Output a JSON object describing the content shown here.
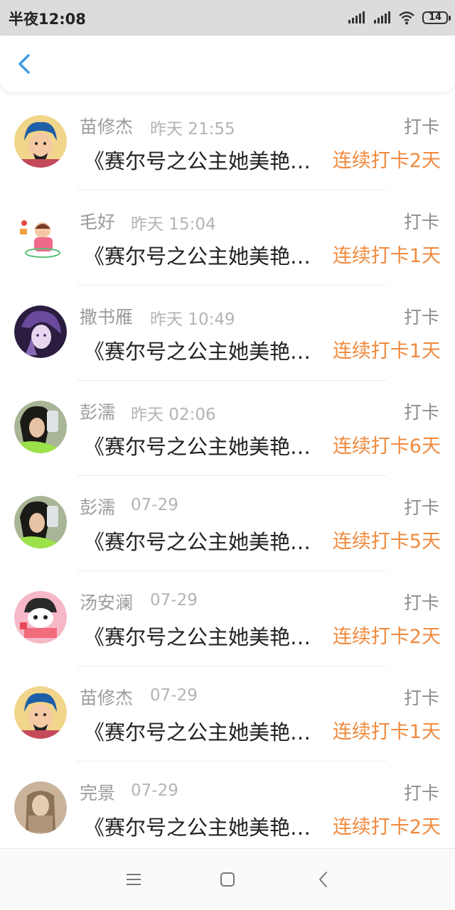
{
  "status_bar": {
    "time": "半夜12:08",
    "battery": "14"
  },
  "colors": {
    "accent_blue": "#3a9be8",
    "streak_orange": "#f08a3e"
  },
  "header": {
    "back_icon": "chevron-left-icon"
  },
  "entries": [
    {
      "name": "苗修杰",
      "time": "昨天 21:55",
      "type": "打卡",
      "content": "《赛尔号之公主她美艳无双》",
      "streak": "连续打卡2天"
    },
    {
      "name": "毛好",
      "time": "昨天 15:04",
      "type": "打卡",
      "content": "《赛尔号之公主她美艳无双》",
      "streak": "连续打卡1天"
    },
    {
      "name": "撒书雁",
      "time": "昨天 10:49",
      "type": "打卡",
      "content": "《赛尔号之公主她美艳无双》",
      "streak": "连续打卡1天"
    },
    {
      "name": "彭濡",
      "time": "昨天 02:06",
      "type": "打卡",
      "content": "《赛尔号之公主她美艳无双》",
      "streak": "连续打卡6天"
    },
    {
      "name": "彭濡",
      "time": "07-29",
      "type": "打卡",
      "content": "《赛尔号之公主她美艳无双》",
      "streak": "连续打卡5天"
    },
    {
      "name": "汤安澜",
      "time": "07-29",
      "type": "打卡",
      "content": "《赛尔号之公主她美艳无双》",
      "streak": "连续打卡2天"
    },
    {
      "name": "苗修杰",
      "time": "07-29",
      "type": "打卡",
      "content": "《赛尔号之公主她美艳无双》",
      "streak": "连续打卡1天"
    },
    {
      "name": "完景",
      "time": "07-29",
      "type": "打卡",
      "content": "《赛尔号之公主她美艳无双》",
      "streak": "连续打卡2天"
    }
  ],
  "system_nav": {
    "menu_icon": "menu-icon",
    "home_icon": "home-square-icon",
    "back_icon": "back-triangle-icon"
  }
}
